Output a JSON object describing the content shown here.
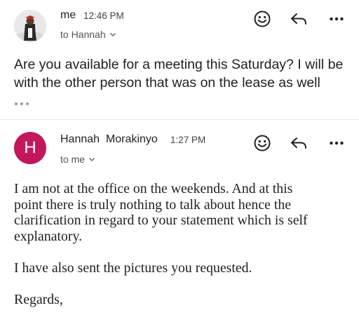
{
  "messages": [
    {
      "sender": "me",
      "time": "12:46 PM",
      "recipient_line": "to Hannah",
      "body_lines": [
        "Are you available for a meeting this Saturday? I will be",
        "with the other person that was on the lease as well"
      ],
      "avatar": "profile-photo",
      "actions": [
        "emoji-reaction-icon",
        "reply-icon",
        "more-options-icon"
      ]
    },
    {
      "sender": "Hannah  Morakinyo",
      "time": "1:27 PM",
      "recipient_line": "to me",
      "avatar_letter": "H",
      "avatar_color": "#c2185b",
      "body_paragraphs": [
        [
          "I am not at the office on the weekends. And at this",
          "point there is truly nothing to talk about hence the",
          "clarification in regard to your statement which is self",
          "explanatory."
        ],
        [
          "I have also sent the pictures you requested."
        ],
        [
          "Regards,"
        ]
      ],
      "actions": [
        "emoji-reaction-icon",
        "reply-icon",
        "more-options-icon"
      ]
    }
  ]
}
